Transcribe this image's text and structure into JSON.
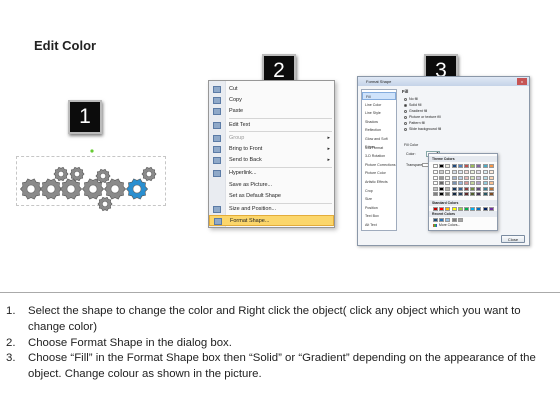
{
  "title": "Edit Color",
  "badges": [
    "1",
    "2",
    "3"
  ],
  "context_menu": {
    "items": [
      {
        "label": "Cut",
        "icon": "scissors-icon",
        "disabled": false,
        "submenu": false
      },
      {
        "label": "Copy",
        "icon": "copy-icon",
        "disabled": false,
        "submenu": false
      },
      {
        "label": "Paste",
        "icon": "paste-icon",
        "disabled": false,
        "submenu": false
      },
      {
        "label": "Edit Text",
        "icon": "edit-text-icon",
        "disabled": false,
        "submenu": false
      },
      {
        "label": "Group",
        "icon": "group-icon",
        "disabled": true,
        "submenu": true
      },
      {
        "label": "Bring to Front",
        "icon": "bring-front-icon",
        "disabled": false,
        "submenu": true
      },
      {
        "label": "Send to Back",
        "icon": "send-back-icon",
        "disabled": false,
        "submenu": true
      },
      {
        "label": "Hyperlink...",
        "icon": "hyperlink-icon",
        "disabled": false,
        "submenu": false
      },
      {
        "label": "Save as Picture...",
        "icon": "",
        "disabled": false,
        "submenu": false
      },
      {
        "label": "Set as Default Shape",
        "icon": "",
        "disabled": false,
        "submenu": false
      },
      {
        "label": "Size and Position...",
        "icon": "size-icon",
        "disabled": false,
        "submenu": false
      },
      {
        "label": "Format Shape...",
        "icon": "format-shape-icon",
        "disabled": false,
        "submenu": false,
        "highlighted": true
      }
    ]
  },
  "dialog": {
    "title": "Format Shape",
    "close": "x",
    "categories": [
      "Fill",
      "Line Color",
      "Line Style",
      "Shadow",
      "Reflection",
      "Glow and Soft Edges",
      "3-D Format",
      "3-D Rotation",
      "Picture Corrections",
      "Picture Color",
      "Artistic Effects",
      "Crop",
      "Size",
      "Position",
      "Text Box",
      "Alt Text"
    ],
    "selected_category": "Fill",
    "heading": "Fill",
    "options": [
      "No fill",
      "Solid fill",
      "Gradient fill",
      "Picture or texture fill",
      "Pattern fill",
      "Slide background fill"
    ],
    "selected_option": "Solid fill",
    "sub_heading": "Fill Color",
    "color_label": "Color:",
    "transparency_label": "Transparency:",
    "close_button": "Close"
  },
  "palette": {
    "theme_label": "Theme Colors",
    "standard_label": "Standard Colors",
    "recent_label": "Recent Colors",
    "more_label": "More Colors...",
    "theme_top": [
      "#ffffff",
      "#000000",
      "#eeece1",
      "#1f497d",
      "#4f81bd",
      "#c0504d",
      "#9bbb59",
      "#8064a2",
      "#4bacc6",
      "#f79646"
    ],
    "standard": [
      "#c00000",
      "#ff0000",
      "#ffc000",
      "#ffff00",
      "#92d050",
      "#00b050",
      "#00b0f0",
      "#0070c0",
      "#002060",
      "#7030a0"
    ],
    "recent": [
      "#1f4e79",
      "#2e75b6",
      "#9dc3e6",
      "#7f7f7f",
      "#a5a5a5"
    ]
  },
  "steps": [
    {
      "num": "1.",
      "text": "Select the shape to change the color and Right click the object( click any object which you want to change color)"
    },
    {
      "num": "2.",
      "text": "Choose Format Shape in the dialog box."
    },
    {
      "num": "3.",
      "text": "Choose “Fill” in the Format Shape box then “Solid” or “Gradient” depending on the appearance of the object. Change colour as shown in the picture."
    }
  ],
  "colors": {
    "gear": "#8a8a8a",
    "gear_selected": "#2a8fd0",
    "menu_highlight": "#fbd66b"
  }
}
